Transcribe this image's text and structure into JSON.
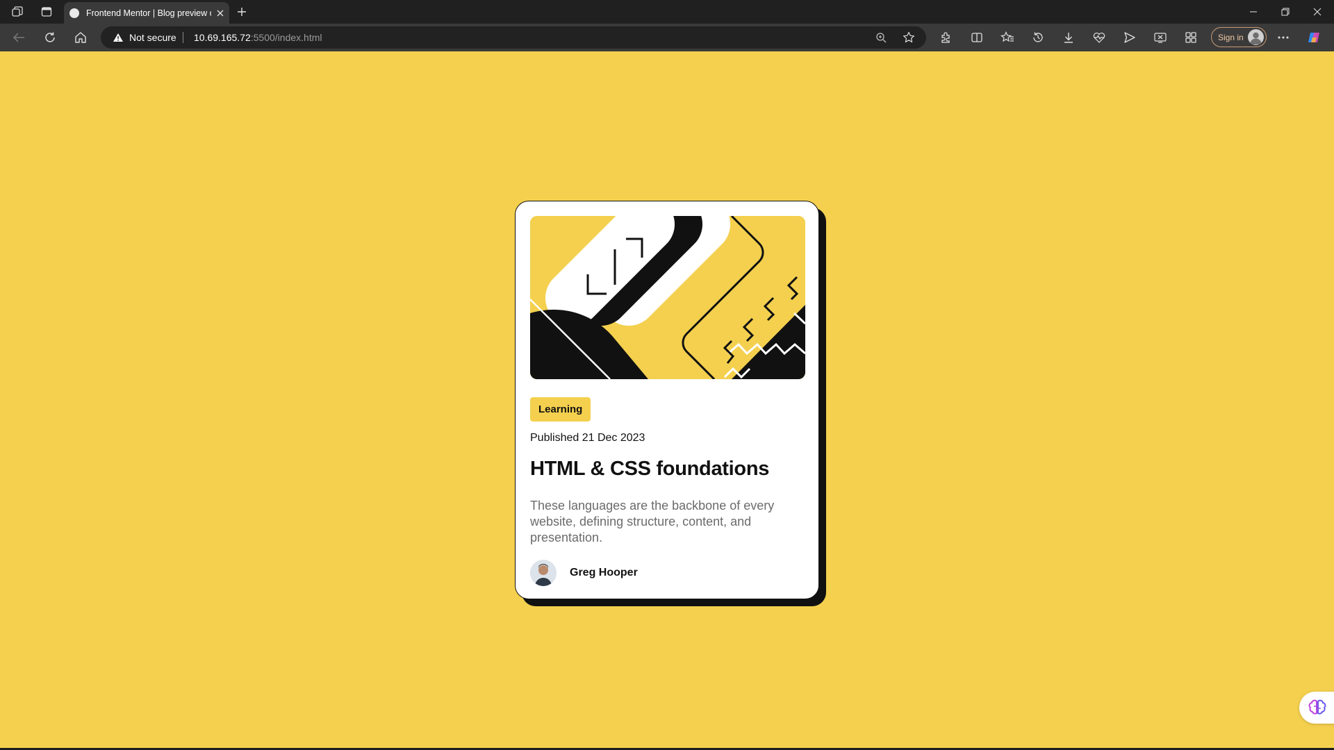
{
  "browser": {
    "tab_title": "Frontend Mentor | Blog preview c",
    "security_label": "Not secure",
    "url_host": "10.69.165.72",
    "url_rest": ":5500/index.html",
    "signin_label": "Sign in"
  },
  "card": {
    "tag": "Learning",
    "published": "Published 21 Dec 2023",
    "title": "HTML & CSS foundations",
    "description": "These languages are the backbone of every website, defining structure, content, and presentation.",
    "author": "Greg Hooper"
  },
  "colors": {
    "background": "#f4d04e",
    "card": "#ffffff",
    "ink": "#111111",
    "muted_text": "#6b6b6b"
  },
  "icons": [
    "workspaces-icon",
    "tab-actions-icon",
    "close-icon",
    "plus-icon",
    "back-icon",
    "refresh-icon",
    "home-icon",
    "warning-icon",
    "zoom-icon",
    "star-icon",
    "extensions-icon",
    "split-screen-icon",
    "favorites-icon",
    "history-icon",
    "download-icon",
    "performance-icon",
    "share-icon",
    "screenshot-icon",
    "collections-icon",
    "more-icon",
    "copilot-icon",
    "brain-icon"
  ]
}
